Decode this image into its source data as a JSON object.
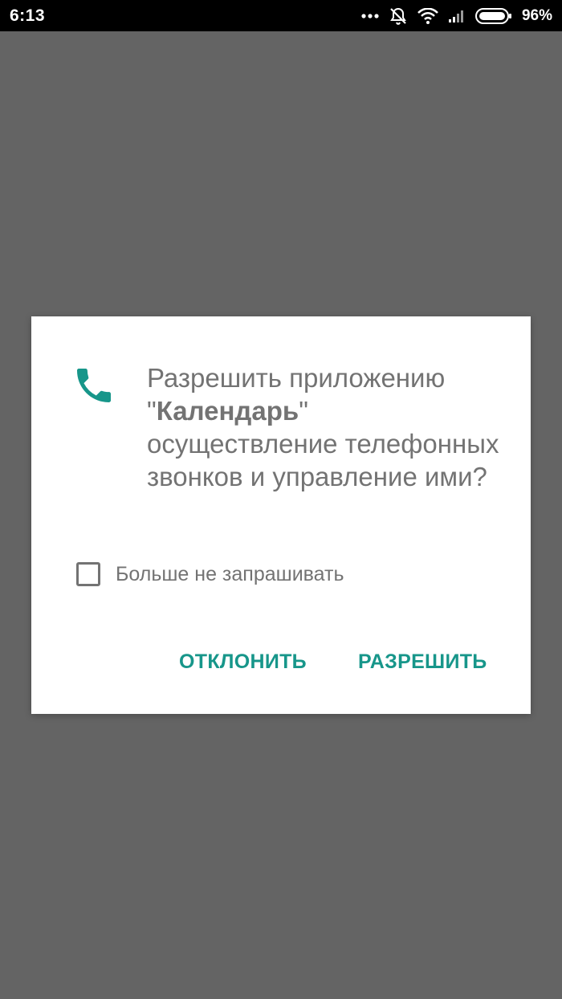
{
  "status_bar": {
    "time": "6:13",
    "more_icon": "more-dots-icon",
    "alarm_icon": "alarm-off-icon",
    "wifi_icon": "wifi-icon",
    "signal_icon": "signal-icon",
    "battery_icon": "battery-icon",
    "battery_percent": "96%"
  },
  "dialog": {
    "icon": "phone-icon",
    "message_before": "Разрешить приложению \"",
    "app_name": "Календарь",
    "message_after": "\" осуществление телефонных звонков и управление ими?",
    "dont_ask_label": "Больше не запрашивать",
    "dont_ask_checked": false,
    "deny_label": "ОТКЛОНИТЬ",
    "allow_label": "РАЗРЕШИТЬ",
    "accent_color": "#17968a"
  },
  "colors": {
    "scrim": "#646464",
    "dialog_background": "#ffffff",
    "text": "#737373"
  }
}
